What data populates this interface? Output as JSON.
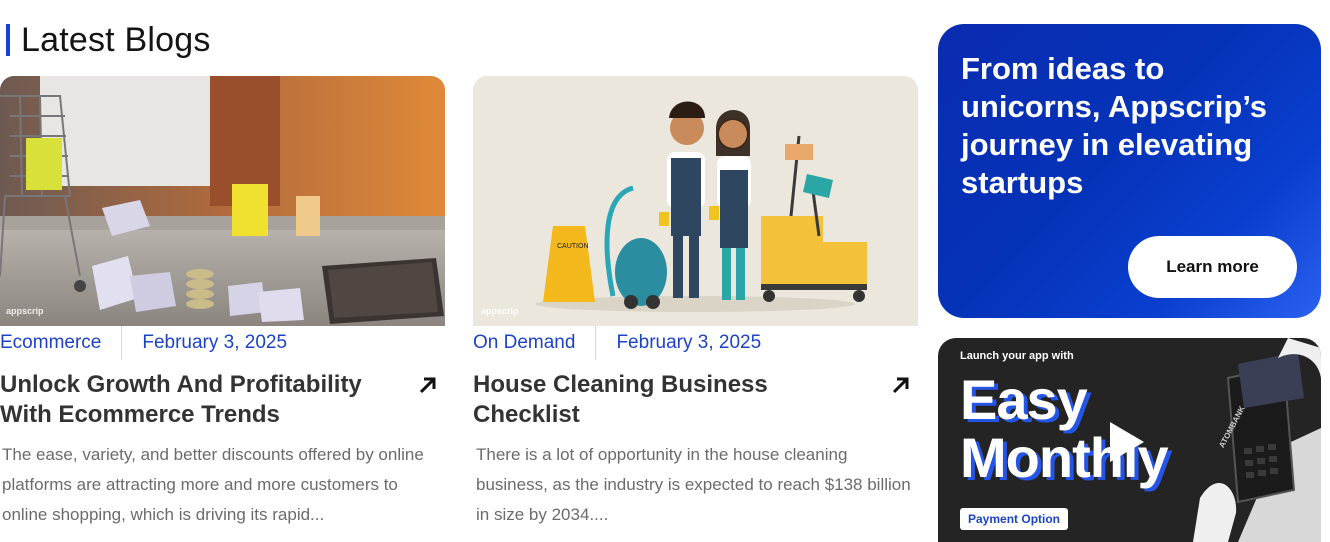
{
  "section": {
    "title": "Latest Blogs"
  },
  "posts": [
    {
      "category": "Ecommerce",
      "date": "February 3, 2025",
      "title": "Unlock Growth And Profitability With Ecommerce Trends",
      "excerpt": "The ease, variety, and better discounts offered by online platforms are attracting more and more customers to online shopping, which is driving its rapid...",
      "watermark": "appscrip"
    },
    {
      "category": "On Demand",
      "date": "February 3, 2025",
      "title": "House Cleaning Business Checklist",
      "excerpt": "There is a lot of opportunity in the house cleaning business, as the industry is expected to reach $138 billion in size by 2034....",
      "watermark": "appscrip"
    }
  ],
  "promo": {
    "heading": "From ideas to unicorns, Appscrip’s journey in elevating startups",
    "button": "Learn more"
  },
  "ad": {
    "kicker": "Launch your app with",
    "line1": "Easy",
    "line2": "Monthly",
    "badge": "Payment Option",
    "card_text": "ATOMBANK"
  },
  "colors": {
    "accent": "#1d43c4",
    "promo_bg": "#0533b8",
    "ad_bg": "#242424"
  }
}
